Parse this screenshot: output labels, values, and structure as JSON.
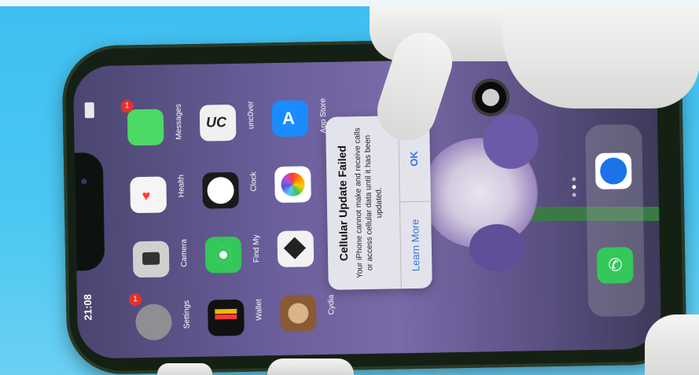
{
  "status": {
    "time": "21:08"
  },
  "apps": [
    {
      "name": "Messages",
      "badge": "1",
      "icon": "messages-icon",
      "color": "#4cd964"
    },
    {
      "name": "Health",
      "icon": "health-heart-icon",
      "color": "#f5f5f5"
    },
    {
      "name": "Camera",
      "icon": "camera-icon",
      "color": "#d0d0d0"
    },
    {
      "name": "Settings",
      "badge": "1",
      "icon": "settings-gear-icon",
      "color": "#8e8e93"
    },
    {
      "name": "unc0ver",
      "icon": "uc-icon",
      "color": "#f0f0f0"
    },
    {
      "name": "Clock",
      "icon": "clock-icon",
      "color": "#1a1a1a"
    },
    {
      "name": "Find My",
      "icon": "find-my-icon",
      "color": "#34c759"
    },
    {
      "name": "Wallet",
      "icon": "wallet-icon",
      "color": "#111111"
    },
    {
      "name": "App Store",
      "icon": "app-store-icon",
      "color": "#1a8cff"
    },
    {
      "name": "Photos",
      "icon": "photos-icon",
      "color": "#ffffff"
    },
    {
      "name": "Checkra1n",
      "icon": "diamond-icon",
      "color": "#f2f2f2"
    },
    {
      "name": "Cydia",
      "icon": "cydia-icon",
      "color": "#8a5a35"
    }
  ],
  "dialog": {
    "title": "Cellular Update Failed",
    "message": "Your iPhone cannot make and receive calls or access cellular data until it has been updated.",
    "learn_more": "Learn More",
    "ok": "OK"
  },
  "dock": [
    {
      "icon": "safari-compass-icon",
      "color": "#ffffff"
    },
    {
      "icon": "phone-icon",
      "color": "#34c759"
    }
  ]
}
